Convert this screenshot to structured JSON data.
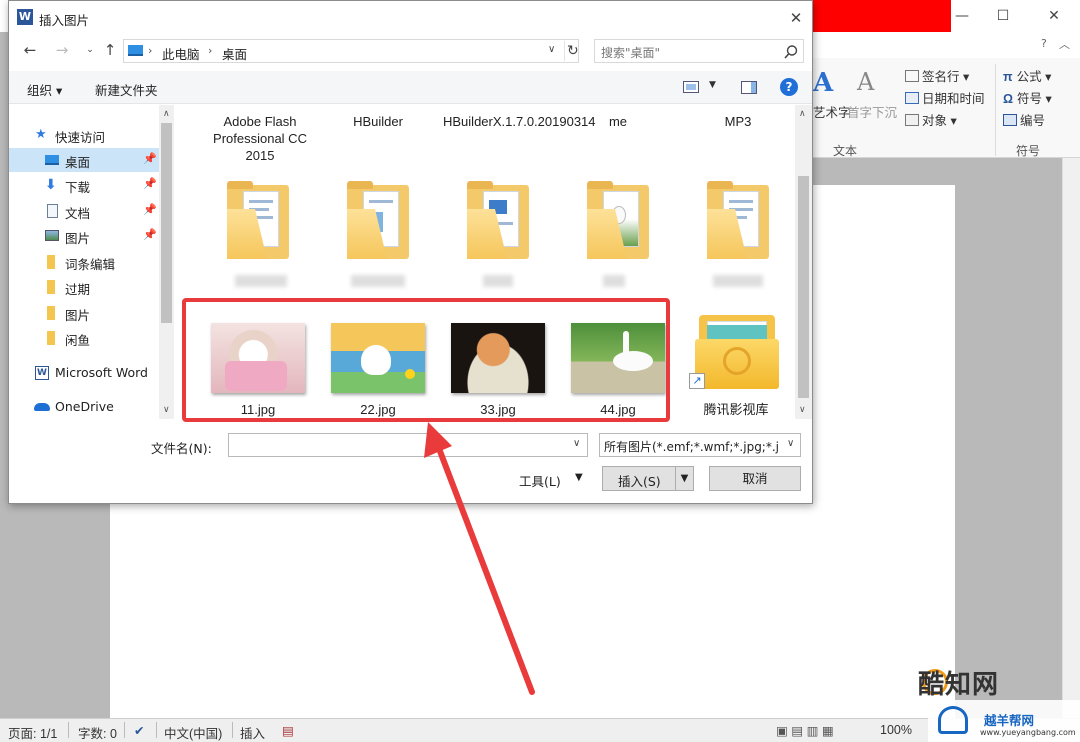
{
  "word": {
    "ribbon": {
      "insert_items": [
        "签名行",
        "日期和时间",
        "对象"
      ],
      "text_buttons": [
        "艺术字",
        "首字下沉"
      ],
      "symbol_items": [
        "公式",
        "符号",
        "编号"
      ],
      "group_text": "文本",
      "group_symbol": "符号"
    },
    "statusbar": {
      "page": "页面: 1/1",
      "words": "字数: 0",
      "language": "中文(中国)",
      "mode": "插入",
      "zoom": "100%"
    }
  },
  "watermarks": {
    "site1": "酷知网",
    "site2": "越羊帮网",
    "site2_url": "www.yueyangbang.com"
  },
  "dialog": {
    "title": "插入图片",
    "address": {
      "crumbs": [
        "此电脑",
        "桌面"
      ]
    },
    "search_placeholder": "搜索\"桌面\"",
    "toolbar": {
      "organize": "组织 ▾",
      "new_folder": "新建文件夹",
      "help": "?"
    },
    "nav": [
      {
        "label": "快速访问",
        "icon": "star-icon",
        "pinned": false
      },
      {
        "label": "桌面",
        "icon": "desktop-icon",
        "pinned": true,
        "selected": true
      },
      {
        "label": "下载",
        "icon": "download-icon",
        "pinned": true
      },
      {
        "label": "文档",
        "icon": "document-icon",
        "pinned": true
      },
      {
        "label": "图片",
        "icon": "pictures-icon",
        "pinned": true
      },
      {
        "label": "词条编辑",
        "icon": "folder-icon",
        "pinned": false
      },
      {
        "label": "过期",
        "icon": "folder-icon",
        "pinned": false
      },
      {
        "label": "图片",
        "icon": "folder-icon",
        "pinned": false
      },
      {
        "label": "闲鱼",
        "icon": "folder-icon",
        "pinned": false
      },
      {
        "label": "Microsoft Word",
        "icon": "word-icon",
        "pinned": false
      },
      {
        "label": "OneDrive",
        "icon": "cloud-icon",
        "pinned": false
      }
    ],
    "files_row1": [
      "Adobe Flash Professional CC 2015",
      "HBuilder",
      "HBuilderX.1.7.0.20190314",
      "me",
      "MP3"
    ],
    "files_row3": [
      {
        "name": "11.jpg",
        "type": "image"
      },
      {
        "name": "22.jpg",
        "type": "image"
      },
      {
        "name": "33.jpg",
        "type": "image"
      },
      {
        "name": "44.jpg",
        "type": "image"
      },
      {
        "name": "腾讯影视库",
        "type": "shortcut-folder"
      }
    ],
    "filename_label": "文件名(N):",
    "filename_value": "",
    "filetype": "所有图片(*.emf;*.wmf;*.jpg;*.j",
    "tools_label": "工具(L)",
    "insert_label": "插入(S)",
    "cancel_label": "取消"
  },
  "colors": {
    "highlight": "#e93b3b",
    "selection": "#cce4f7",
    "word_blue": "#2b579a"
  }
}
